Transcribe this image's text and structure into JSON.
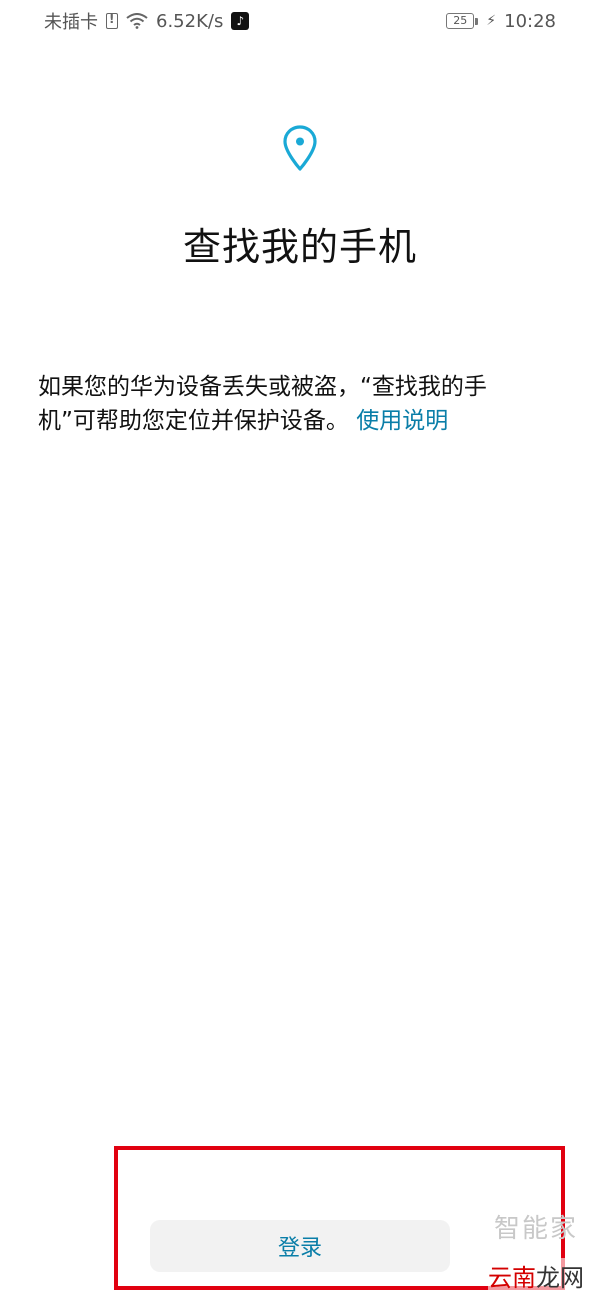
{
  "status_bar": {
    "carrier": "未插卡",
    "speed": "6.52K/s",
    "battery": "25",
    "time": "10:28"
  },
  "main": {
    "icon": "location-pin-icon",
    "title": "查找我的手机",
    "description": "如果您的华为设备丢失或被盗，“查找我的手机”可帮助您定位并保护设备。",
    "help_link": "使用说明"
  },
  "footer": {
    "login_label": "登录"
  },
  "watermark": {
    "top": "智能家",
    "bottom_red": "云南",
    "bottom_rest": "龙网"
  },
  "colors": {
    "accent": "#0a7ea8",
    "pin": "#1aa9d6",
    "highlight": "#e10010"
  }
}
